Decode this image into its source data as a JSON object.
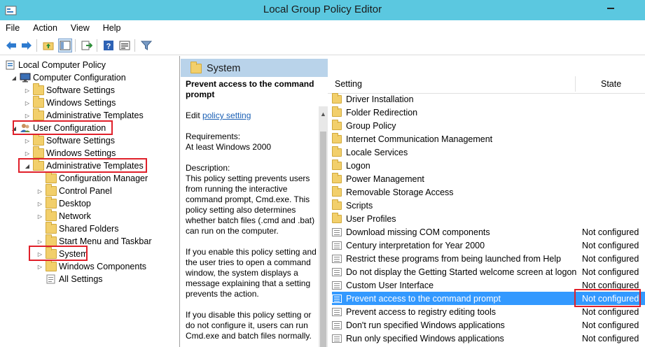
{
  "window": {
    "title": "Local Group Policy Editor"
  },
  "menu": [
    "File",
    "Action",
    "View",
    "Help"
  ],
  "toolbar_icons": [
    "back-icon",
    "forward-icon",
    "up-folder-icon",
    "show-hide-tree-icon",
    "export-list-icon",
    "help-icon",
    "properties-icon",
    "filter-icon"
  ],
  "tree": [
    {
      "label": "Local Computer Policy",
      "level": 0,
      "arrow": "",
      "icon": "policy-icon"
    },
    {
      "label": "Computer Configuration",
      "level": 1,
      "arrow": "◢",
      "icon": "computer-icon"
    },
    {
      "label": "Software Settings",
      "level": 2,
      "arrow": "▷",
      "icon": "folder-icon"
    },
    {
      "label": "Windows Settings",
      "level": 2,
      "arrow": "▷",
      "icon": "folder-icon"
    },
    {
      "label": "Administrative Templates",
      "level": 2,
      "arrow": "▷",
      "icon": "folder-icon"
    },
    {
      "label": "User Configuration",
      "level": 1,
      "arrow": "◢",
      "icon": "user-icon"
    },
    {
      "label": "Software Settings",
      "level": 2,
      "arrow": "▷",
      "icon": "folder-icon"
    },
    {
      "label": "Windows Settings",
      "level": 2,
      "arrow": "▷",
      "icon": "folder-icon"
    },
    {
      "label": "Administrative Templates",
      "level": 2,
      "arrow": "◢",
      "icon": "folder-icon"
    },
    {
      "label": "Configuration Manager",
      "level": 3,
      "arrow": "",
      "icon": "folder-icon"
    },
    {
      "label": "Control Panel",
      "level": 3,
      "arrow": "▷",
      "icon": "folder-icon"
    },
    {
      "label": "Desktop",
      "level": 3,
      "arrow": "▷",
      "icon": "folder-icon"
    },
    {
      "label": "Network",
      "level": 3,
      "arrow": "▷",
      "icon": "folder-icon"
    },
    {
      "label": "Shared Folders",
      "level": 3,
      "arrow": "",
      "icon": "folder-icon"
    },
    {
      "label": "Start Menu and Taskbar",
      "level": 3,
      "arrow": "▷",
      "icon": "folder-icon"
    },
    {
      "label": "System",
      "level": 3,
      "arrow": "▷",
      "icon": "folder-icon"
    },
    {
      "label": "Windows Components",
      "level": 3,
      "arrow": "▷",
      "icon": "folder-icon"
    },
    {
      "label": "All Settings",
      "level": 3,
      "arrow": "",
      "icon": "settings-icon"
    }
  ],
  "middle": {
    "header": "System",
    "policy_title": "Prevent access to the command prompt",
    "edit_prefix": "Edit",
    "edit_link": "policy setting",
    "requirements_label": "Requirements:",
    "requirements_value": "At least Windows 2000",
    "description_label": "Description:",
    "description": "This policy setting prevents users from running the interactive command prompt, Cmd.exe.  This policy setting also determines whether batch files (.cmd and .bat) can run on the computer.",
    "enable_text": "If you enable this policy setting and the user tries to open a command window, the system displays a message explaining that a setting prevents the action.",
    "disable_text": "If you disable this policy setting or do not configure it, users can run Cmd.exe and batch files normally."
  },
  "list": {
    "col_setting": "Setting",
    "col_state": "State",
    "rows": [
      {
        "name": "Driver Installation",
        "type": "folder",
        "state": ""
      },
      {
        "name": "Folder Redirection",
        "type": "folder",
        "state": ""
      },
      {
        "name": "Group Policy",
        "type": "folder",
        "state": ""
      },
      {
        "name": "Internet Communication Management",
        "type": "folder",
        "state": ""
      },
      {
        "name": "Locale Services",
        "type": "folder",
        "state": ""
      },
      {
        "name": "Logon",
        "type": "folder",
        "state": ""
      },
      {
        "name": "Power Management",
        "type": "folder",
        "state": ""
      },
      {
        "name": "Removable Storage Access",
        "type": "folder",
        "state": ""
      },
      {
        "name": "Scripts",
        "type": "folder",
        "state": ""
      },
      {
        "name": "User Profiles",
        "type": "folder",
        "state": ""
      },
      {
        "name": "Download missing COM components",
        "type": "policy",
        "state": "Not configured"
      },
      {
        "name": "Century interpretation for Year 2000",
        "type": "policy",
        "state": "Not configured"
      },
      {
        "name": "Restrict these programs from being launched from Help",
        "type": "policy",
        "state": "Not configured"
      },
      {
        "name": "Do not display the Getting Started welcome screen at logon",
        "type": "policy",
        "state": "Not configured"
      },
      {
        "name": "Custom User Interface",
        "type": "policy",
        "state": "Not configured"
      },
      {
        "name": "Prevent access to the command prompt",
        "type": "policy",
        "state": "Not configured",
        "selected": true
      },
      {
        "name": "Prevent access to registry editing tools",
        "type": "policy",
        "state": "Not configured"
      },
      {
        "name": "Don't run specified Windows applications",
        "type": "policy",
        "state": "Not configured"
      },
      {
        "name": "Run only specified Windows applications",
        "type": "policy",
        "state": "Not configured"
      }
    ]
  }
}
